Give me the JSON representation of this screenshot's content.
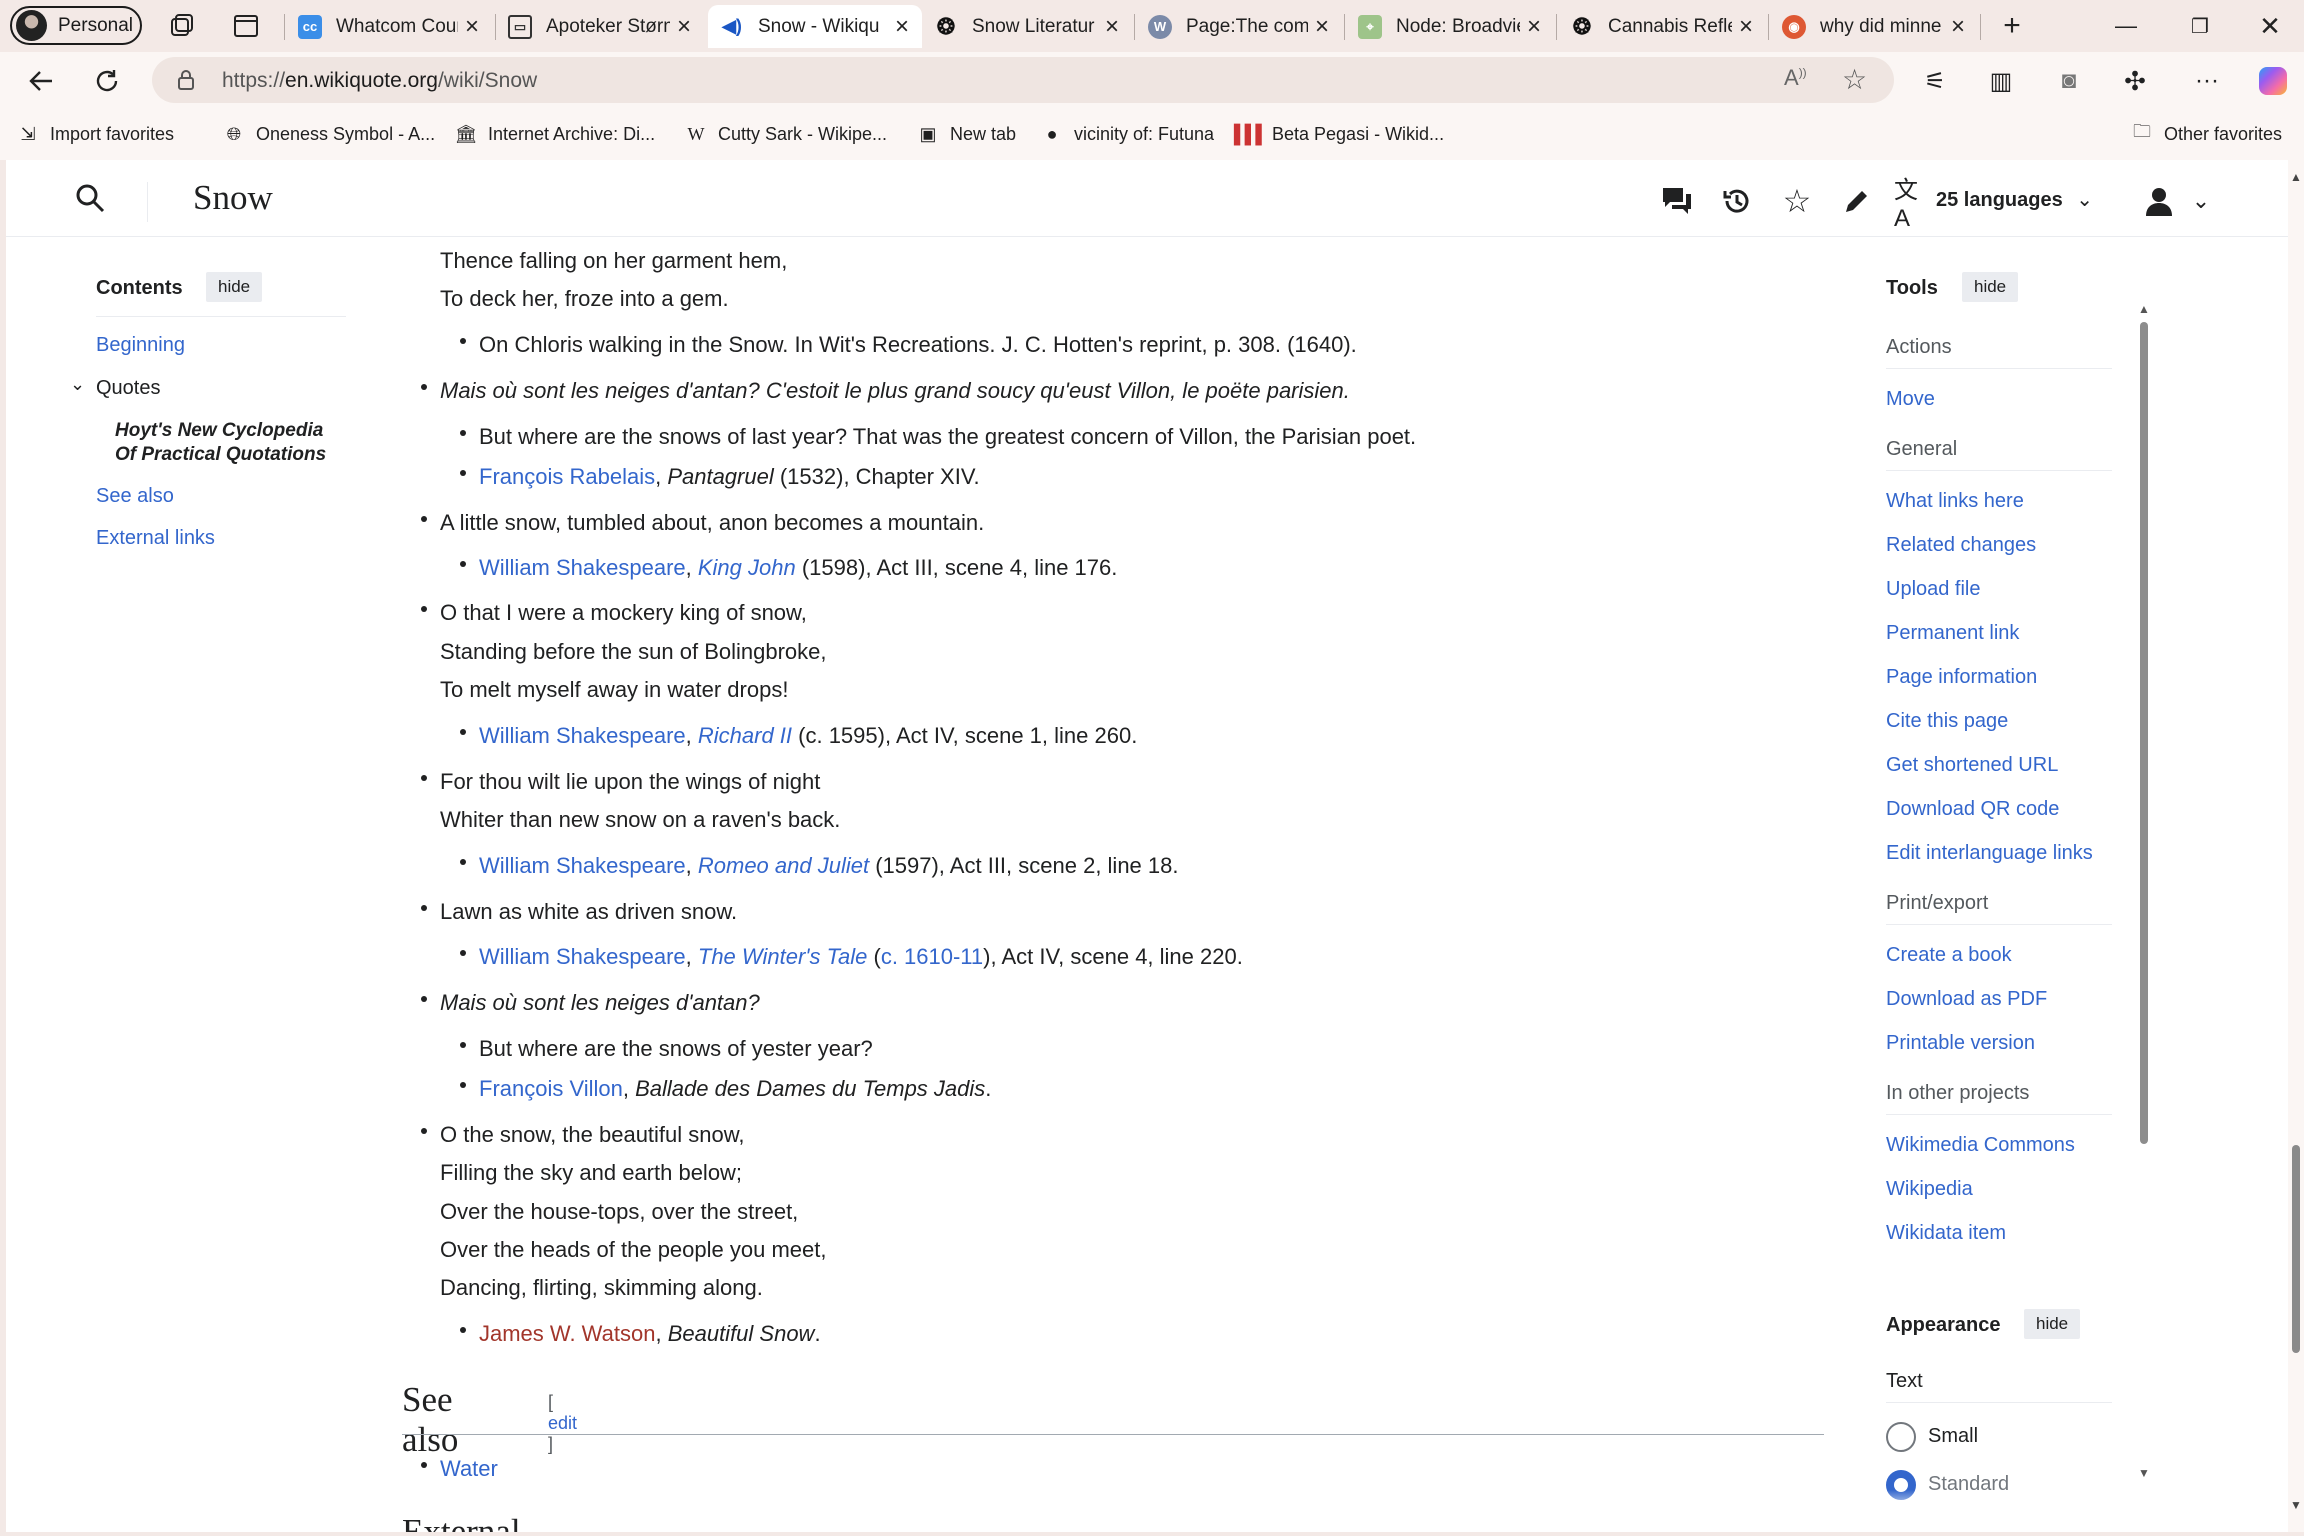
{
  "browser": {
    "profile": "Personal",
    "tabs": [
      {
        "title": "Whatcom Cour",
        "icon": "cc-icon",
        "active": false
      },
      {
        "title": "Apoteker Størm",
        "icon": "book-icon",
        "active": false
      },
      {
        "title": "Snow - Wikiqu",
        "icon": "audio-icon",
        "active": true
      },
      {
        "title": "Snow Literatur",
        "icon": "openai-icon",
        "active": false
      },
      {
        "title": "Page:The comp",
        "icon": "wikisource-icon",
        "active": false
      },
      {
        "title": "Node: Broadvie",
        "icon": "map-icon",
        "active": false
      },
      {
        "title": "Cannabis Refle",
        "icon": "openai-icon",
        "active": false
      },
      {
        "title": "why did minne",
        "icon": "duckduckgo-icon",
        "active": false
      }
    ],
    "url_prefix": "https://",
    "url_host": "en.wikiquote.org",
    "url_path": "/wiki/Snow",
    "favorites": [
      {
        "label": "Import favorites",
        "icon": "import-icon"
      },
      {
        "label": "Oneness Symbol - A...",
        "icon": "globe-icon"
      },
      {
        "label": "Internet Archive: Di...",
        "icon": "archive-icon"
      },
      {
        "label": "Cutty Sark - Wikipe...",
        "icon": "wikipedia-icon"
      },
      {
        "label": "New tab",
        "icon": "newtab-icon"
      },
      {
        "label": "vicinity of: Futuna",
        "icon": "dark-circle-icon"
      },
      {
        "label": "Beta Pegasi - Wikid...",
        "icon": "wikidata-icon"
      }
    ],
    "other_favorites": "Other favorites"
  },
  "page": {
    "title": "Snow",
    "languages": "25 languages",
    "toc": {
      "heading": "Contents",
      "hide": "hide",
      "items": {
        "beginning": "Beginning",
        "quotes": "Quotes",
        "hoyt_line1": "Hoyt's New Cyclopedia",
        "hoyt_line2": "Of Practical Quotations",
        "see_also": "See also",
        "external_links": "External links"
      }
    },
    "content": {
      "l1": "Thence falling on her garment hem,",
      "l2": "To deck her, froze into a gem.",
      "s1": "On Chloris walking in the Snow. In Wit's Recreations. J. C. Hotten's reprint, p. 308. (1640).",
      "q2": "Mais où sont les neiges d'antan? C'estoit le plus grand soucy qu'eust Villon, le poëte parisien.",
      "s2a": "But where are the snows of last year? That was the greatest concern of Villon, the Parisian poet.",
      "s2b_author": "François Rabelais",
      "s2b_work": "Pantagruel",
      "s2b_rest": " (1532), Chapter XIV.",
      "q3": "A little snow, tumbled about, anon becomes a mountain.",
      "s3_author": "William Shakespeare",
      "s3_work": "King John",
      "s3_rest": " (1598), Act III, scene 4, line 176.",
      "q4a": "O that I were a mockery king of snow,",
      "q4b": "Standing before the sun of Bolingbroke,",
      "q4c": "To melt myself away in water drops!",
      "s4_author": "William Shakespeare",
      "s4_work": "Richard II",
      "s4_rest": " (c. 1595), Act IV, scene 1, line 260.",
      "q5a": "For thou wilt lie upon the wings of night",
      "q5b": "Whiter than new snow on a raven's back.",
      "s5_author": "William Shakespeare",
      "s5_work": "Romeo and Juliet",
      "s5_rest": " (1597), Act III, scene 2, line 18.",
      "q6": "Lawn as white as driven snow.",
      "s6_author": "William Shakespeare",
      "s6_work": "The Winter's Tale",
      "s6_open": " (",
      "s6_date": "c. 1610-11",
      "s6_rest": "), Act IV, scene 4, line 220.",
      "q7": "Mais où sont les neiges d'antan?",
      "s7a": "But where are the snows of yester year?",
      "s7b_author": "François Villon",
      "s7b_work": "Ballade des Dames du Temps Jadis",
      "q8a": "O the snow, the beautiful snow,",
      "q8b": "Filling the sky and earth below;",
      "q8c": "Over the house-tops, over the street,",
      "q8d": "Over the heads of the people you meet,",
      "q8e": "Dancing, flirting, skimming along.",
      "s8_author": "James W. Watson",
      "s8_work": "Beautiful Snow",
      "comma": ", ",
      "period": ".",
      "see_also_heading": "See also",
      "edit_open": "[ ",
      "edit": "edit",
      "edit_close": " ]",
      "see_also_item": "Water",
      "next_heading": "External links"
    },
    "tools": {
      "heading": "Tools",
      "hide": "hide",
      "actions": "Actions",
      "move": "Move",
      "general": "General",
      "what_links_here": "What links here",
      "related_changes": "Related changes",
      "upload_file": "Upload file",
      "permanent_link": "Permanent link",
      "page_information": "Page information",
      "cite_this_page": "Cite this page",
      "get_shortened_url": "Get shortened URL",
      "download_qr": "Download QR code",
      "edit_interlanguage": "Edit interlanguage links",
      "print_export": "Print/export",
      "create_book": "Create a book",
      "download_pdf": "Download as PDF",
      "printable_version": "Printable version",
      "other_projects": "In other projects",
      "wikimedia_commons": "Wikimedia Commons",
      "wikipedia": "Wikipedia",
      "wikidata_item": "Wikidata item"
    },
    "appearance": {
      "heading": "Appearance",
      "hide": "hide",
      "text_label": "Text",
      "opt_small": "Small",
      "opt_standard": "Standard"
    }
  },
  "colors": {
    "link": "#3366cc",
    "new_link": "#a2362b",
    "chrome": "#f3e9e6"
  }
}
